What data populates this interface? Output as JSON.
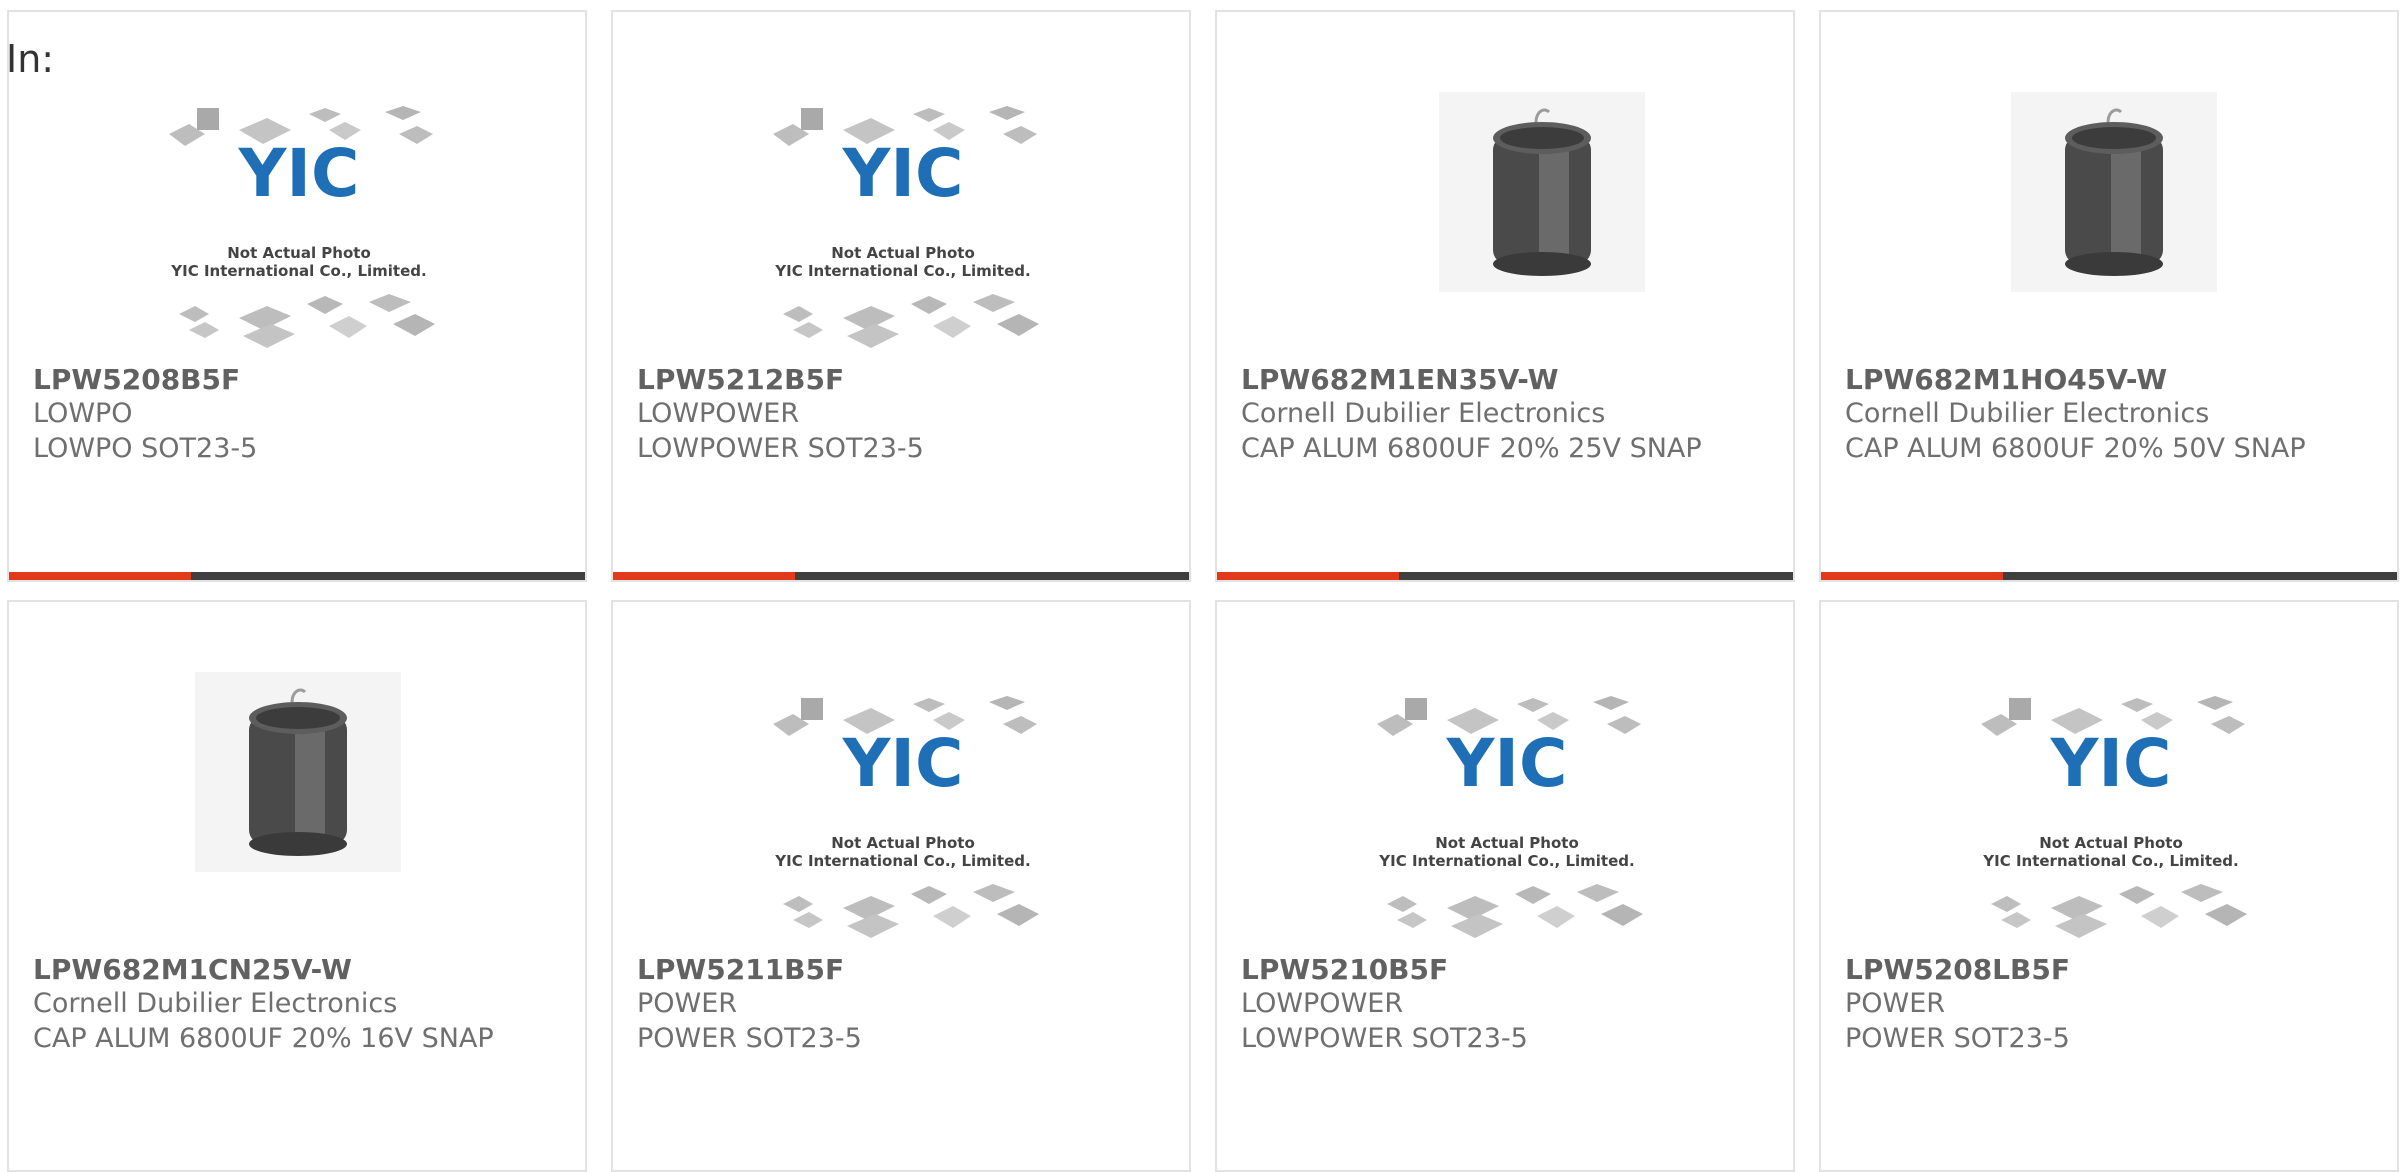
{
  "header": {
    "in_label": "In:"
  },
  "placeholder": {
    "brand": "YIC",
    "line1": "Not Actual Photo",
    "line2": "YIC International Co., Limited."
  },
  "colors": {
    "accent": "#e0391c",
    "bar": "#3f3f3f",
    "border": "#e2e2e2",
    "text": "#6f6f6f"
  },
  "products": [
    {
      "pn": "LPW5208B5F",
      "mfr": "LOWPO",
      "desc": "LOWPO SOT23-5",
      "image": "placeholder-icon"
    },
    {
      "pn": "LPW5212B5F",
      "mfr": "LOWPOWER",
      "desc": "LOWPOWER SOT23-5",
      "image": "placeholder-icon"
    },
    {
      "pn": "LPW682M1EN35V-W",
      "mfr": "Cornell Dubilier Electronics",
      "desc": "CAP ALUM 6800UF 20% 25V SNAP",
      "image": "capacitor-icon"
    },
    {
      "pn": "LPW682M1HO45V-W",
      "mfr": "Cornell Dubilier Electronics",
      "desc": "CAP ALUM 6800UF 20% 50V SNAP",
      "image": "capacitor-icon"
    },
    {
      "pn": "LPW682M1CN25V-W",
      "mfr": "Cornell Dubilier Electronics",
      "desc": "CAP ALUM 6800UF 20% 16V SNAP",
      "image": "capacitor-icon"
    },
    {
      "pn": "LPW5211B5F",
      "mfr": "POWER",
      "desc": "POWER SOT23-5",
      "image": "placeholder-icon"
    },
    {
      "pn": "LPW5210B5F",
      "mfr": "LOWPOWER",
      "desc": "LOWPOWER SOT23-5",
      "image": "placeholder-icon"
    },
    {
      "pn": "LPW5208LB5F",
      "mfr": "POWER",
      "desc": "POWER SOT23-5",
      "image": "placeholder-icon"
    }
  ]
}
